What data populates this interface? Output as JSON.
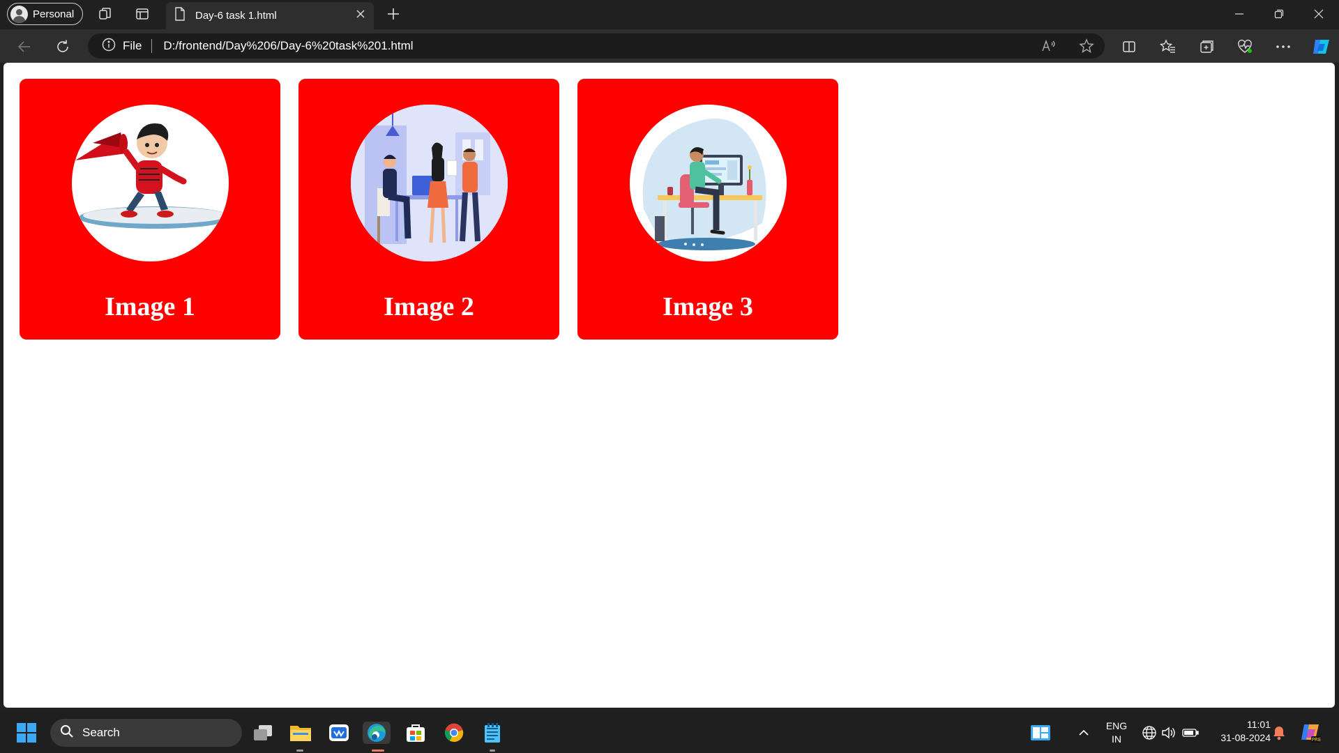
{
  "browser": {
    "profile_label": "Personal",
    "tab_title": "Day-6 task 1.html",
    "address_scheme_label": "File",
    "url": "D:/frontend/Day%206/Day-6%20task%201.html"
  },
  "page": {
    "cards": [
      {
        "caption": "Image 1",
        "image": "cartoon-boy-megaphone-surfboard"
      },
      {
        "caption": "Image 2",
        "image": "office-team-meeting-illustration"
      },
      {
        "caption": "Image 3",
        "image": "developer-at-desk-illustration"
      }
    ],
    "card_color": "#ff0000"
  },
  "taskbar": {
    "search_placeholder": "Search",
    "language_line1": "ENG",
    "language_line2": "IN",
    "time": "11:01",
    "date": "31-08-2024"
  }
}
